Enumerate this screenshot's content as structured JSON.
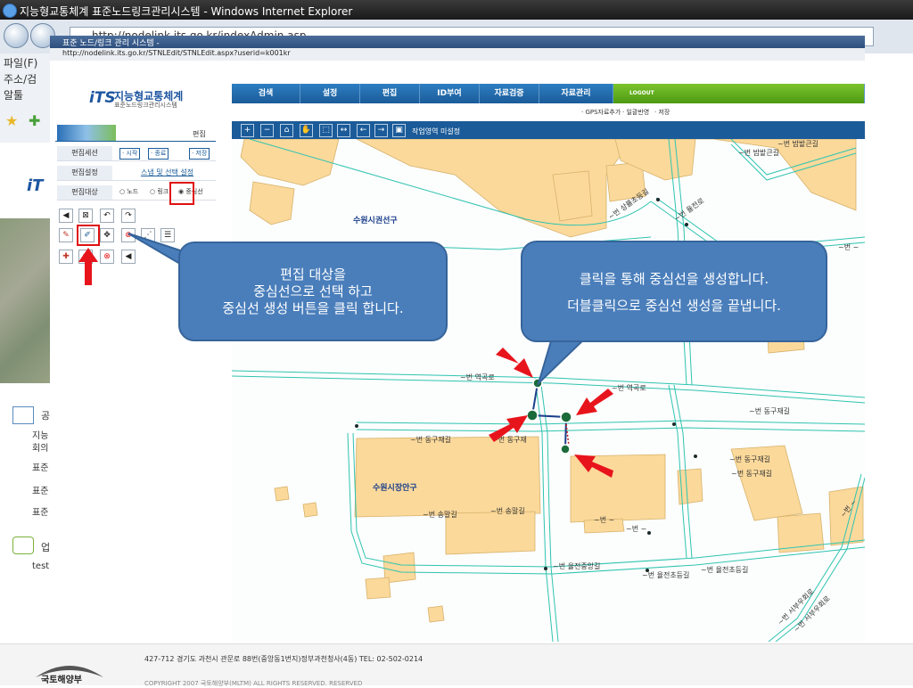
{
  "outer_window": {
    "title": "지능형교통체계 표준노드링크관리시스템 - Windows Internet Explorer",
    "address": "http://nodelink.its.go.kr/indexAdmin.asp",
    "menu": [
      "파일(F)",
      "주소/검",
      "알툴"
    ],
    "left_items": [
      "공",
      "지능",
      "회의",
      "표준",
      "표준",
      "표준",
      "업",
      "test"
    ]
  },
  "inner_window": {
    "title": "표준 노드/링크 관리 시스템 -",
    "address": "http://nodelink.its.go.kr/STNLEdit/STNLEdit.aspx?userid=k001kr"
  },
  "header": {
    "logo_mark": "iTS",
    "logo_name": "지능형교통체계",
    "logo_sub": "표준노드링크관리시스템",
    "tabs": [
      "검색",
      "설정",
      "편집",
      "ID부여",
      "자료검증",
      "자료관리",
      "LOGOUT"
    ],
    "subnav": [
      "· GPS자료추가",
      "· 일괄반영",
      "· 저장"
    ]
  },
  "panel": {
    "title": "편집",
    "rows": {
      "session_label": "편집세션",
      "session_buttons": [
        "· 시작",
        "· 종료",
        "· 저장"
      ],
      "setting_label": "편집설정",
      "setting_link": "스냅 및 선택 설정",
      "target_label": "편집대상",
      "target_options": [
        "노드",
        "링크",
        "중심선"
      ],
      "target_selected": "중심선"
    },
    "tools_row1": [
      "◀",
      "⊠",
      "↶",
      "↷"
    ],
    "tools_row2": [
      "✎",
      "✐",
      "✥",
      "⊗",
      "⋰",
      "☰"
    ],
    "tools_row3": [
      "✚",
      "⊖",
      "⊗",
      "◀"
    ]
  },
  "map": {
    "toolbar_icons": [
      "zoom-in-icon",
      "zoom-out-icon",
      "home-icon",
      "pan-icon",
      "select-icon",
      "measure-icon",
      "back-icon",
      "forward-icon",
      "extent-icon"
    ],
    "toolbar_glyphs": [
      "+",
      "−",
      "⌂",
      "✋",
      "⬚",
      "↔",
      "←",
      "→",
      "▣"
    ],
    "status": "작업영역 미설정",
    "labels": {
      "district1": "수원시권선구",
      "district2": "수원시장안구",
      "road_a": "~번 역곡로",
      "road_a2": "~번 역곡로",
      "road_b": "~번 동구재길",
      "road_b2": "~번 동구재길",
      "road_b3": "~번 동구재길",
      "road_b4": "~번 동구재길",
      "road_c": "~번 송말길",
      "road_c2": "~번 송말길",
      "road_d": "~번 율전중앙길",
      "road_d2": "~번 율전초등길",
      "road_d3": "~번 율전초등길",
      "road_e": "~번 밤밭큰길",
      "road_e2": "~번 밤밭큰길",
      "road_f": "~번 상률초등길",
      "road_g": "~번 율전로",
      "road_h": "~번 ~",
      "road_i": "~번 ~",
      "road_j": "~번 서부우회로",
      "road_k": "~번 서부우회로",
      "road_l": "~번 동구재",
      "road_m": "~번 ~",
      "road_n": "~번 ~"
    }
  },
  "callouts": {
    "left": [
      "편집 대상을",
      "중심선으로 선택 하고",
      "중심선 생성 버튼을 클릭 합니다."
    ],
    "right": [
      "클릭을 통해 중심선을 생성합니다.",
      "더블클릭으로 중심선 생성을 끝냅니다."
    ]
  },
  "footer": {
    "address": "427-712 경기도 과천시 관문로 88번(중앙동1번지)정부과천청사(4동)  TEL: 02-502-0214",
    "copyright": "COPYRIGHT  2007 국토해양부(MLTM) ALL RIGHTS RESERVED.  RESERVED",
    "logo_text": "국토해양부"
  },
  "colors": {
    "nav_blue": "#1b5b99",
    "nav_green": "#5aa51a",
    "callout": "#4a7ebb",
    "block": "#fbd99b",
    "road": "#2fc4b0",
    "arrow": "#e8141c"
  }
}
